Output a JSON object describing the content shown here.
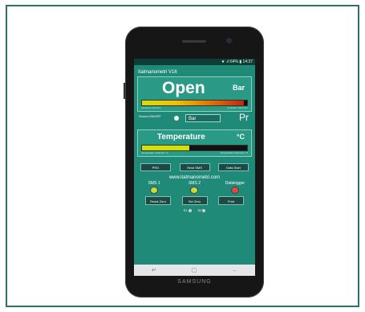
{
  "status": {
    "text": "★ .ıl 64% ▮ 14:37"
  },
  "app": {
    "title": "Italmanometri V16"
  },
  "pressure": {
    "value": "Open",
    "unit": "Bar",
    "min_label": "pressure minimum",
    "max_label": "pressure maximum"
  },
  "sound": {
    "label": "Sound ON/OFF",
    "field_value": "Bar",
    "pr": "Pr"
  },
  "temperature": {
    "title": "Temperature",
    "unit": "°C",
    "min_label": "temperature minimum °C",
    "max_label": "temperature maximum °C"
  },
  "buttons": {
    "prg": "PRG",
    "send_sms": "Send SMS",
    "data_start": "Data Start"
  },
  "link": "www.italmanometri.com",
  "indicators": [
    {
      "label": "SMS 1",
      "color": "#c6dc3a"
    },
    {
      "label": "SMS 2",
      "color": "#c6dc3a"
    },
    {
      "label": "Datalogger",
      "color": "#e04a40"
    }
  ],
  "buttons2": {
    "reset_zero": "Reset Zero",
    "set_zero": "Set Zero",
    "print": "Print"
  },
  "sims": {
    "s1": "S1",
    "s2": "S2"
  },
  "nav": {
    "back": "↵",
    "home": "▢",
    "recent": "←"
  },
  "brand": "SAMSUNG"
}
